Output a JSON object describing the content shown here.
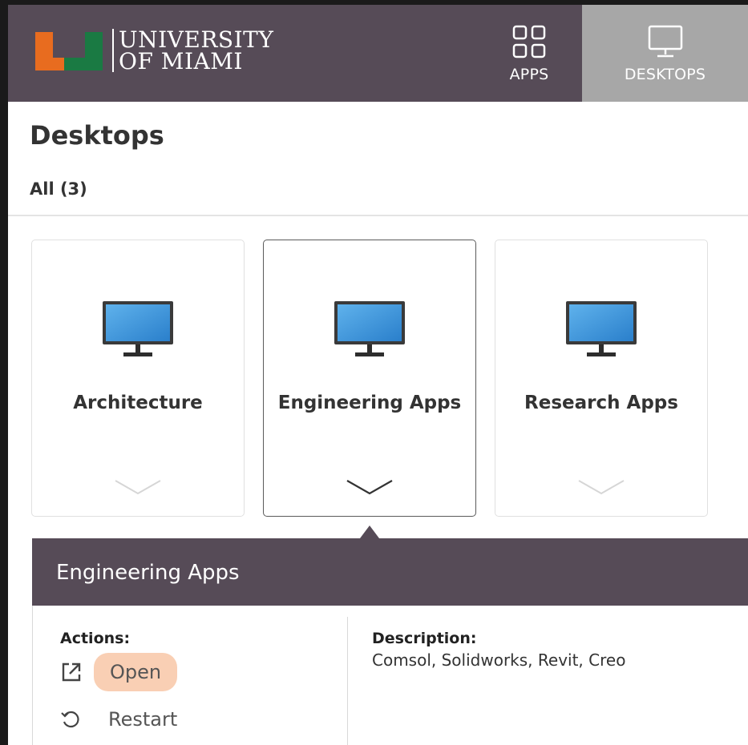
{
  "header": {
    "logo_line1": "UNIVERSITY",
    "logo_line2": "OF MIAMI",
    "nav": {
      "apps_label": "APPS",
      "desktops_label": "DESKTOPS"
    },
    "colors": {
      "bar": "#564b57",
      "active_tab": "#a7a7a7",
      "logo_orange": "#e86c1f",
      "logo_green": "#1a7a43"
    }
  },
  "page": {
    "title": "Desktops",
    "filter_all": "All (3)"
  },
  "desktops": [
    {
      "label": "Architecture",
      "icon": "monitor-icon",
      "selected": false
    },
    {
      "label": "Engineering Apps",
      "icon": "monitor-icon",
      "selected": true
    },
    {
      "label": "Research Apps",
      "icon": "monitor-icon",
      "selected": false
    }
  ],
  "detail": {
    "title": "Engineering Apps",
    "actions_label": "Actions:",
    "open_label": "Open",
    "restart_label": "Restart",
    "description_label": "Description:",
    "description_text": "Comsol, Solidworks, Revit, Creo",
    "highlight_color": "#f9cfb4"
  }
}
